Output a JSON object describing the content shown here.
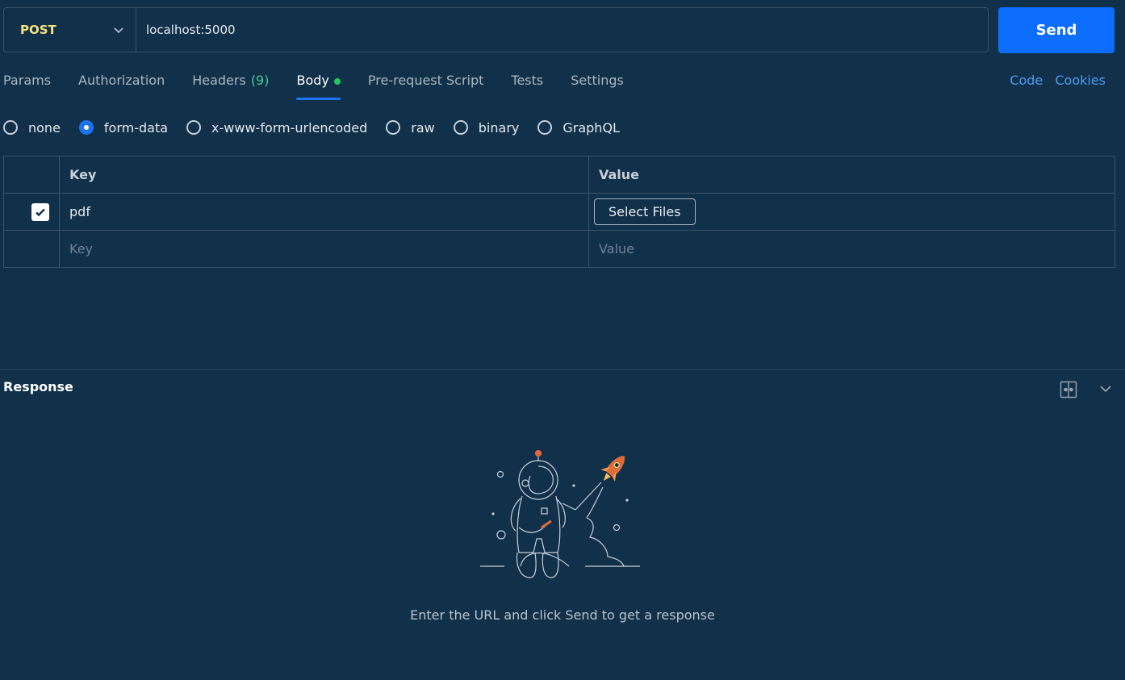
{
  "request": {
    "method": "POST",
    "url": "localhost:5000",
    "send_label": "Send"
  },
  "tabs": [
    {
      "label": "Params"
    },
    {
      "label": "Authorization"
    },
    {
      "label": "Headers",
      "count": "(9)"
    },
    {
      "label": "Body"
    },
    {
      "label": "Pre-request Script"
    },
    {
      "label": "Tests"
    },
    {
      "label": "Settings"
    }
  ],
  "links": {
    "code": "Code",
    "cookies": "Cookies"
  },
  "body_modes": [
    "none",
    "form-data",
    "x-www-form-urlencoded",
    "raw",
    "binary",
    "GraphQL"
  ],
  "body_mode_selected": "form-data",
  "table": {
    "headers": {
      "key": "Key",
      "value": "Value"
    },
    "rows": [
      {
        "key": "pdf",
        "value_button": "Select Files",
        "checked": true
      }
    ],
    "placeholder": {
      "key": "Key",
      "value": "Value"
    }
  },
  "response": {
    "title": "Response",
    "hint": "Enter the URL and click Send to get a response"
  },
  "colors": {
    "accent": "#1e73f0",
    "background": "#11304a",
    "method": "#f6e17c"
  }
}
